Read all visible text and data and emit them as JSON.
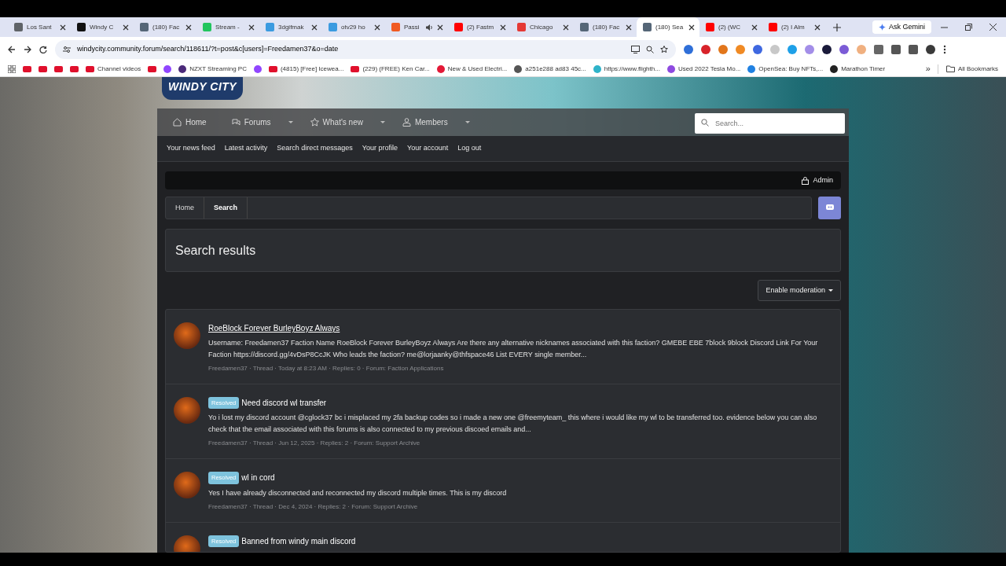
{
  "browser": {
    "tabs": [
      {
        "title": "Los Sant",
        "selected": false,
        "audio": false
      },
      {
        "title": "Windy C",
        "selected": false,
        "audio": false
      },
      {
        "title": "(180) Fac",
        "selected": false,
        "audio": false
      },
      {
        "title": "Stream -",
        "selected": false,
        "audio": false
      },
      {
        "title": "3dgifmak",
        "selected": false,
        "audio": false
      },
      {
        "title": "otv29 ho",
        "selected": false,
        "audio": false
      },
      {
        "title": "Passi",
        "selected": false,
        "audio": true
      },
      {
        "title": "(2) Fastm",
        "selected": false,
        "audio": false
      },
      {
        "title": "Chicago",
        "selected": false,
        "audio": false
      },
      {
        "title": "(180) Fac",
        "selected": false,
        "audio": false
      },
      {
        "title": "(180) Sea",
        "selected": true,
        "audio": false
      },
      {
        "title": "(2) (WC",
        "selected": false,
        "audio": false
      },
      {
        "title": "(2) I Alm",
        "selected": false,
        "audio": false
      }
    ],
    "gemini_button": "Ask Gemini",
    "address": "windycity.community.forum/search/118611/?t=post&c[users]=Freedamen37&o=date",
    "bookmarks": [
      {
        "kind": "youtube"
      },
      {
        "kind": "youtube"
      },
      {
        "kind": "youtube"
      },
      {
        "kind": "youtube"
      },
      {
        "kind": "youtube",
        "label": "Channel videos"
      },
      {
        "kind": "youtube"
      },
      {
        "kind": "twitch"
      },
      {
        "kind": "letter",
        "label": "NZXT Streaming PC"
      },
      {
        "kind": "twitch"
      },
      {
        "kind": "youtube",
        "label": "(4815) [Free] Icewea..."
      },
      {
        "kind": "youtube",
        "label": "(229) (FREE) Ken Car..."
      },
      {
        "kind": "tesla",
        "label": "New & Used Electri..."
      },
      {
        "kind": "globe",
        "label": "a251e288 ad83 45c..."
      },
      {
        "kind": "stripes",
        "label": "https://www.flighth..."
      },
      {
        "kind": "purple",
        "label": "Used 2022 Tesla Mo..."
      },
      {
        "kind": "boat",
        "label": "OpenSea: Buy NFTs,..."
      },
      {
        "kind": "timer",
        "label": "Marathon Timer"
      }
    ],
    "overflow": "»",
    "all_bookmarks": "All Bookmarks"
  },
  "forum": {
    "logo": "WINDY CITY",
    "nav": [
      {
        "label": "Home",
        "dropdown": false
      },
      {
        "label": "Forums",
        "dropdown": true
      },
      {
        "label": "What's new",
        "dropdown": true
      },
      {
        "label": "Members",
        "dropdown": true
      }
    ],
    "search": {
      "placeholder": "Search..."
    },
    "subnav": [
      "Your news feed",
      "Latest activity",
      "Search direct messages",
      "Your profile",
      "Your account",
      "Log out"
    ],
    "admin": "Admin",
    "breadcrumb": [
      {
        "label": "Home",
        "current": false
      },
      {
        "label": "Search",
        "current": true
      }
    ],
    "title": "Search results",
    "moderation_button": "Enable moderation",
    "results": [
      {
        "title": "RoeBlock Forever BurleyBoyz Always",
        "hovered": true,
        "snippet": "Username: Freedamen37 Faction Name RoeBlock Forever BurleyBoyz Always Are there any alternative nicknames associated with this faction? GMEBE EBE 7block 9block Discord Link For Your Faction https://discord.gg/4vDsP8CcJK Who leads the faction? me@lorjaanky@thfspace46 List EVERY single member...",
        "meta": "Freedamen37 · Thread · Today at 8:23 AM · Replies: 0 · Forum: Faction Applications"
      },
      {
        "title": "Need discord wl transfer",
        "prefix": "Resolved",
        "hovered": false,
        "snippet": "Yo i lost my discord account @cglock37 bc i misplaced my 2fa backup codes so i made a new one @freemyteam_ this where i would like my wl to be transferred too. evidence below you can also check that the email associated with this forums is also connected to my previous discoed emails and...",
        "meta": "Freedamen37 · Thread · Jun 12, 2025 · Replies: 2 · Forum: Support Archive"
      },
      {
        "title": "wl in cord",
        "prefix": "Resolved",
        "hovered": false,
        "snippet": "Yes I have already disconnected and reconnected my discord multiple times. This is my discord",
        "meta": "Freedamen37 · Thread · Dec 4, 2024 · Replies: 2 · Forum: Support Archive"
      },
      {
        "title": "Banned from windy main discord",
        "prefix": "Resolved",
        "hovered": false
      }
    ]
  }
}
